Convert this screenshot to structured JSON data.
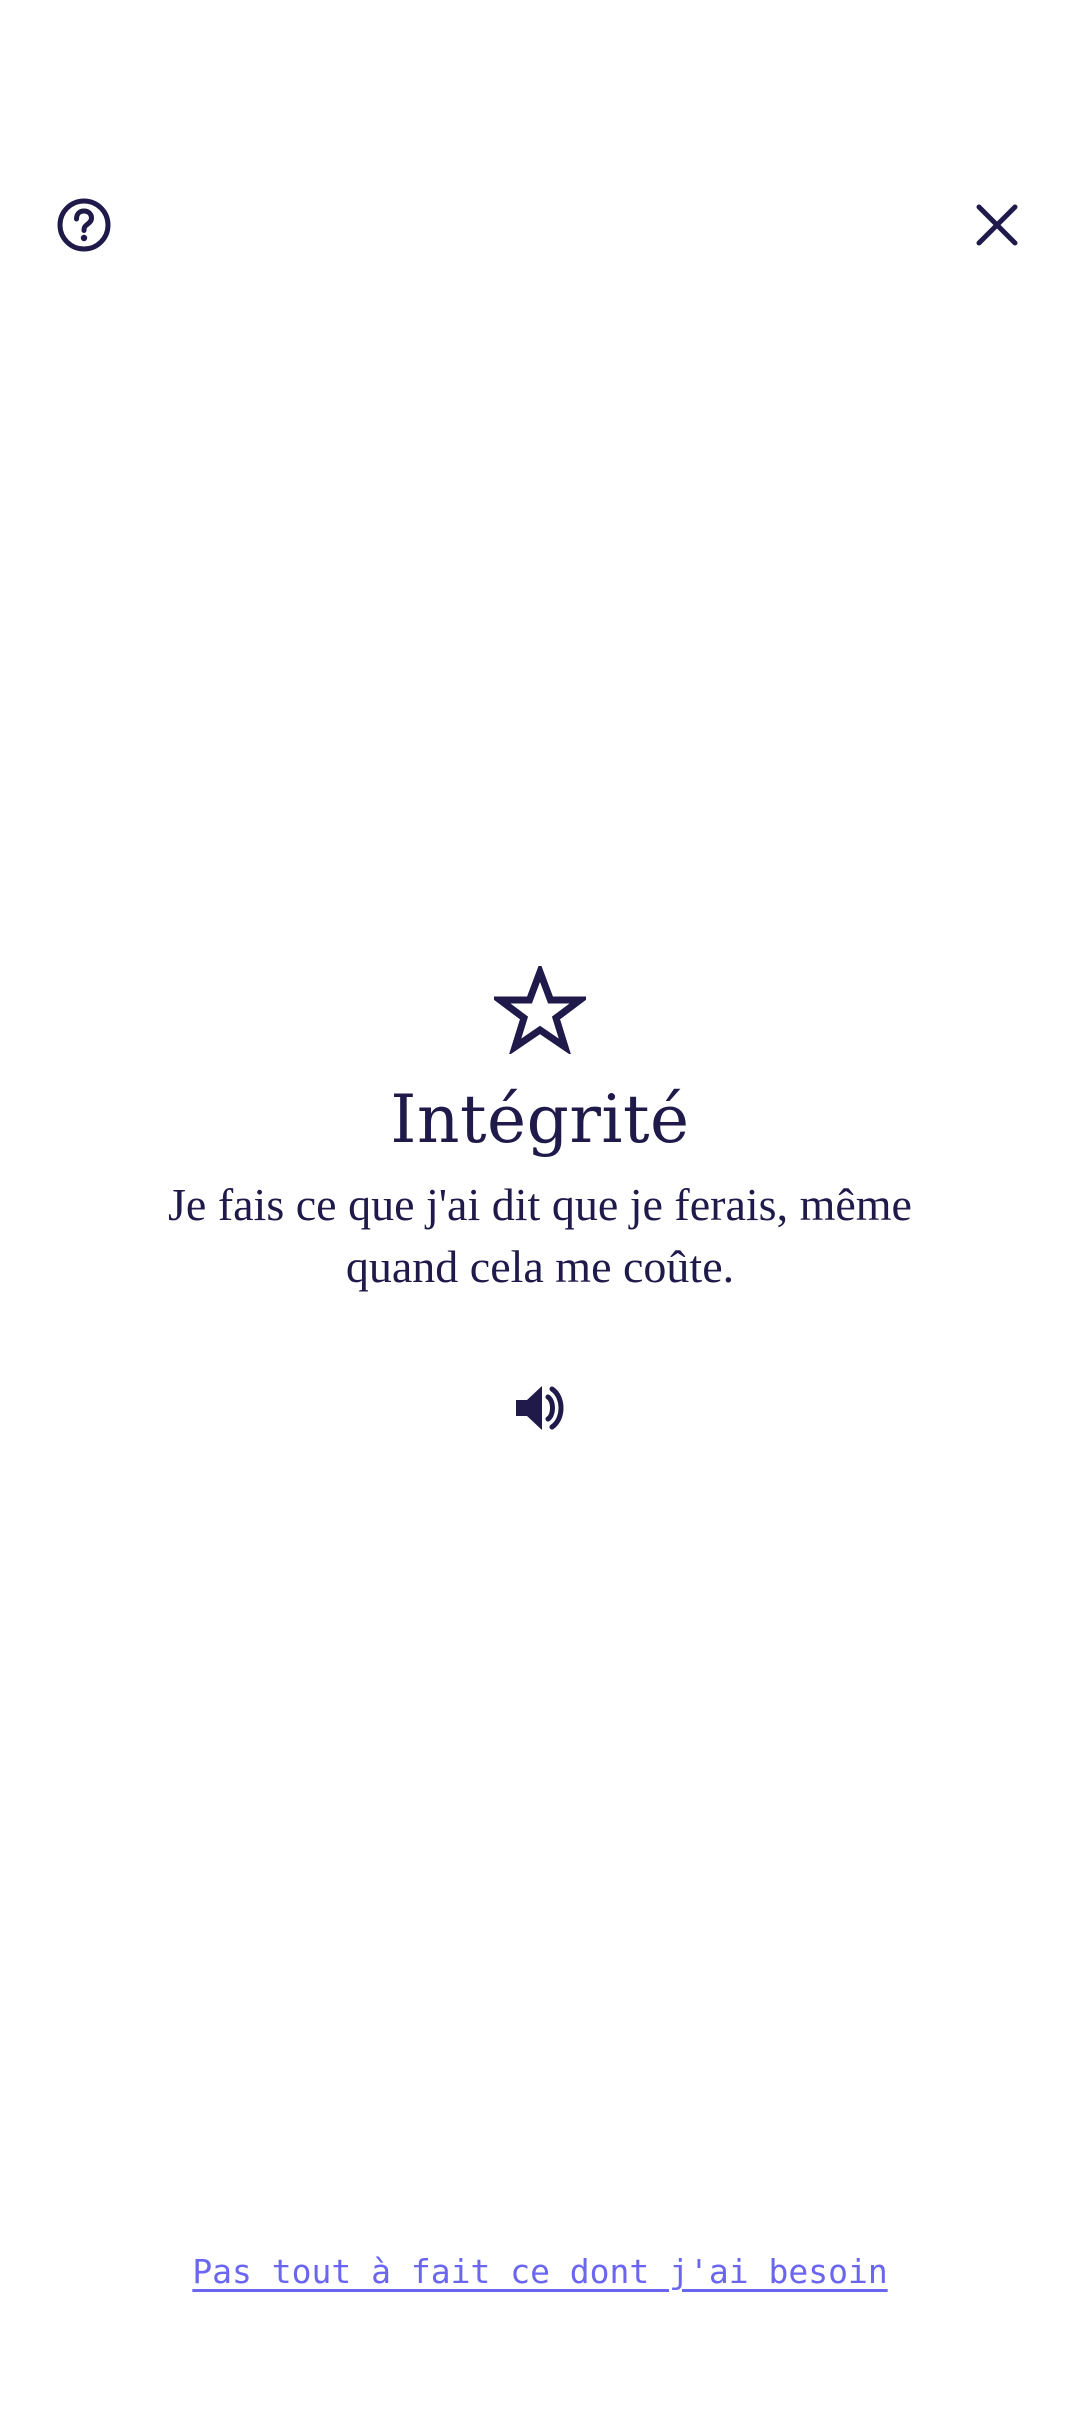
{
  "header": {
    "help_icon": "help-circle-icon",
    "close_icon": "close-icon"
  },
  "value_card": {
    "icon": "star-outline-icon",
    "title": "Intégrité",
    "description": "Je fais ce que j'ai dit que je ferais, même quand cela me coûte.",
    "audio_icon": "speaker-volume-icon"
  },
  "footer": {
    "link_label": "Pas tout à fait ce dont j'ai besoin"
  },
  "colors": {
    "primary": "#1f1a4a",
    "link": "#6b66f0",
    "background": "#ffffff"
  }
}
